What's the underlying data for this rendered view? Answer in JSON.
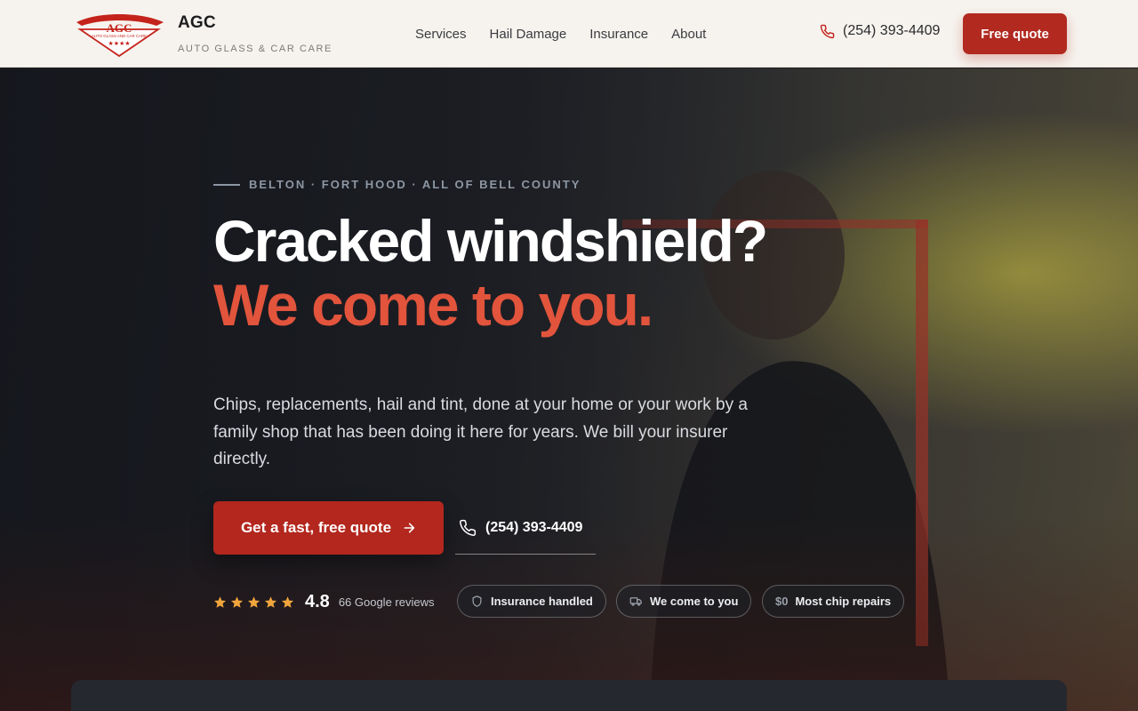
{
  "brand": {
    "name": "AGC",
    "tagline": "AUTO GLASS & CAR CARE",
    "logo_text": "AGC",
    "logo_subtext": "AUTO GLASS AND CAR CARE"
  },
  "nav": {
    "items": [
      {
        "label": "Services"
      },
      {
        "label": "Hail Damage"
      },
      {
        "label": "Insurance"
      },
      {
        "label": "About"
      }
    ]
  },
  "header": {
    "phone": "(254) 393-4409",
    "quote_button": "Free quote"
  },
  "hero": {
    "eyebrow": "BELTON · FORT HOOD · ALL OF BELL COUNTY",
    "headline_line1": "Cracked windshield?",
    "headline_line2": "We come to you.",
    "lede": "Chips, replacements, hail and tint, done at your home or your work by a family shop that has been doing it here for years. We bill your insurer directly.",
    "cta_label": "Get a fast, free quote",
    "phone": "(254) 393-4409",
    "rating": {
      "stars": 5,
      "value": "4.8",
      "count_label": "66 Google reviews"
    },
    "badges": [
      {
        "icon": "shield-icon",
        "label": "Insurance handled"
      },
      {
        "icon": "truck-icon",
        "label": "We come to you"
      },
      {
        "icon": "dollar-icon",
        "prefix": "$0",
        "label": "Most chip repairs"
      }
    ]
  },
  "colors": {
    "accent": "#b3271e",
    "headline_accent": "#e2543c",
    "header_bg": "#f6f3ee",
    "star": "#f0a53c"
  }
}
